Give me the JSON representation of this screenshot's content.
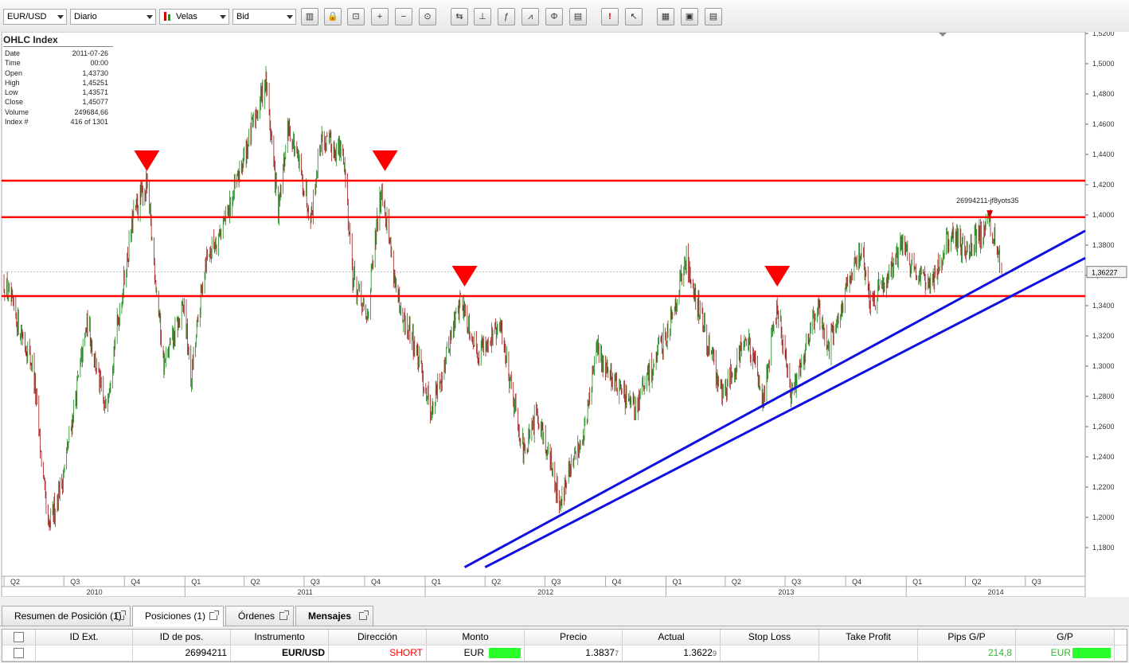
{
  "toolbar": {
    "instrument": "EUR/USD",
    "period": "Diario",
    "chart_type": "Velas",
    "price_side": "Bid",
    "buttons": [
      "bar-chart-icon",
      "lock-icon",
      "zoom-fit-icon",
      "zoom-in-icon",
      "zoom-out-icon",
      "zoom-reset-icon",
      "pan-icon",
      "crosshair-icon",
      "indicator-icon",
      "pattern-icon",
      "fibonacci-icon",
      "notes-icon",
      "alert-icon",
      "cursor-icon",
      "grid-icon",
      "save-icon",
      "template-icon"
    ]
  },
  "info": {
    "title": "OHLC Index",
    "rows": [
      {
        "k": "Date",
        "v": "2011-07-26"
      },
      {
        "k": "Time",
        "v": "00:00"
      },
      {
        "k": "Open",
        "v": "1,43730"
      },
      {
        "k": "High",
        "v": "1,45251"
      },
      {
        "k": "Low",
        "v": "1,43571"
      },
      {
        "k": "Close",
        "v": "1,45077"
      },
      {
        "k": "Volume",
        "v": "249684,66"
      },
      {
        "k": "Index #",
        "v": "416 of 1301"
      }
    ]
  },
  "chart_data": {
    "type": "candlestick",
    "instrument": "EUR/USD",
    "y_ticks": [
      "1,5200",
      "1,5000",
      "1,4800",
      "1,4600",
      "1,4400",
      "1,4200",
      "1,4000",
      "1,3800",
      "1,3600",
      "1,3400",
      "1,3200",
      "1,3000",
      "1,2800",
      "1,2600",
      "1,2400",
      "1,2200",
      "1,2000",
      "1,1800"
    ],
    "ylim": [
      1.16,
      1.52
    ],
    "current_price": "1,36227",
    "order_label": "26994211-jf8yots35",
    "quarters": [
      "Q2",
      "Q3",
      "Q4",
      "Q1",
      "Q2",
      "Q3",
      "Q4",
      "Q1",
      "Q2",
      "Q3",
      "Q4",
      "Q1",
      "Q2",
      "Q3",
      "Q4",
      "Q1",
      "Q2",
      "Q3"
    ],
    "years": [
      "2010",
      "2011",
      "2012",
      "2013",
      "2014"
    ],
    "x_start": "2010-04-01",
    "x_end": "2014-09-30",
    "path": [
      [
        "2010-04-01",
        1.355
      ],
      [
        "2010-05-15",
        1.3
      ],
      [
        "2010-06-07",
        1.19
      ],
      [
        "2010-07-01",
        1.23
      ],
      [
        "2010-08-06",
        1.33
      ],
      [
        "2010-09-01",
        1.27
      ],
      [
        "2010-10-15",
        1.4
      ],
      [
        "2010-11-04",
        1.42
      ],
      [
        "2010-11-30",
        1.3
      ],
      [
        "2010-12-31",
        1.34
      ],
      [
        "2011-01-10",
        1.29
      ],
      [
        "2011-02-01",
        1.37
      ],
      [
        "2011-03-07",
        1.4
      ],
      [
        "2011-05-04",
        1.49
      ],
      [
        "2011-05-23",
        1.4
      ],
      [
        "2011-06-07",
        1.46
      ],
      [
        "2011-07-12",
        1.4
      ],
      [
        "2011-07-26",
        1.45
      ],
      [
        "2011-08-30",
        1.44
      ],
      [
        "2011-09-13",
        1.36
      ],
      [
        "2011-10-04",
        1.33
      ],
      [
        "2011-10-27",
        1.42
      ],
      [
        "2011-11-25",
        1.33
      ],
      [
        "2011-12-12",
        1.32
      ],
      [
        "2012-01-11",
        1.27
      ],
      [
        "2012-02-24",
        1.345
      ],
      [
        "2012-03-20",
        1.31
      ],
      [
        "2012-04-25",
        1.325
      ],
      [
        "2012-05-31",
        1.24
      ],
      [
        "2012-06-20",
        1.27
      ],
      [
        "2012-07-24",
        1.21
      ],
      [
        "2012-08-31",
        1.26
      ],
      [
        "2012-09-17",
        1.31
      ],
      [
        "2012-11-13",
        1.27
      ],
      [
        "2012-12-31",
        1.32
      ],
      [
        "2013-02-01",
        1.37
      ],
      [
        "2013-03-27",
        1.28
      ],
      [
        "2013-05-02",
        1.32
      ],
      [
        "2013-05-29",
        1.28
      ],
      [
        "2013-06-19",
        1.34
      ],
      [
        "2013-07-09",
        1.28
      ],
      [
        "2013-08-20",
        1.34
      ],
      [
        "2013-09-04",
        1.31
      ],
      [
        "2013-10-25",
        1.38
      ],
      [
        "2013-11-07",
        1.34
      ],
      [
        "2013-12-27",
        1.38
      ],
      [
        "2014-02-03",
        1.35
      ],
      [
        "2014-03-13",
        1.39
      ],
      [
        "2014-04-01",
        1.375
      ],
      [
        "2014-05-08",
        1.395
      ],
      [
        "2014-05-26",
        1.362
      ]
    ],
    "horizontal_lines": [
      1.4226,
      1.3985,
      1.3463
    ],
    "trendlines": [
      {
        "from": [
          "2012-03-01",
          1.167
        ],
        "to": [
          "2014-09-30",
          1.3895
        ]
      },
      {
        "from": [
          "2012-04-01",
          1.167
        ],
        "to": [
          "2014-09-30",
          1.3715
        ]
      }
    ],
    "markers": [
      {
        "date": "2010-11-04",
        "price": 1.4226
      },
      {
        "date": "2011-11-01",
        "price": 1.4226
      },
      {
        "date": "2012-03-01",
        "price": 1.3463
      },
      {
        "date": "2013-06-19",
        "price": 1.3463
      }
    ]
  },
  "tabs": [
    {
      "label": "Resumen de Posición (1)",
      "active": false
    },
    {
      "label": "Posiciones (1)",
      "active": true
    },
    {
      "label": "Órdenes",
      "active": false
    },
    {
      "label": "Mensajes",
      "active": false
    }
  ],
  "positions": {
    "headers": [
      "ID Ext.",
      "ID de pos.",
      "Instrumento",
      "Dirección",
      "Monto",
      "Precio",
      "Actual",
      "Stop Loss",
      "Take Profit",
      "Pips G/P",
      "G/P"
    ],
    "row": {
      "ext_id": "",
      "pos_id": "26994211",
      "instrument": "EUR/USD",
      "direction": "SHORT",
      "amount": "EUR",
      "price": "1.3837",
      "price_small": "7",
      "actual": "1.3622",
      "actual_small": "9",
      "stop_loss": "",
      "take_profit": "",
      "pips": "214,8",
      "pl": "EUR"
    },
    "colors": {
      "short": "#ff0000",
      "pips": "#2db82d",
      "bar": "#2bff2b"
    }
  }
}
